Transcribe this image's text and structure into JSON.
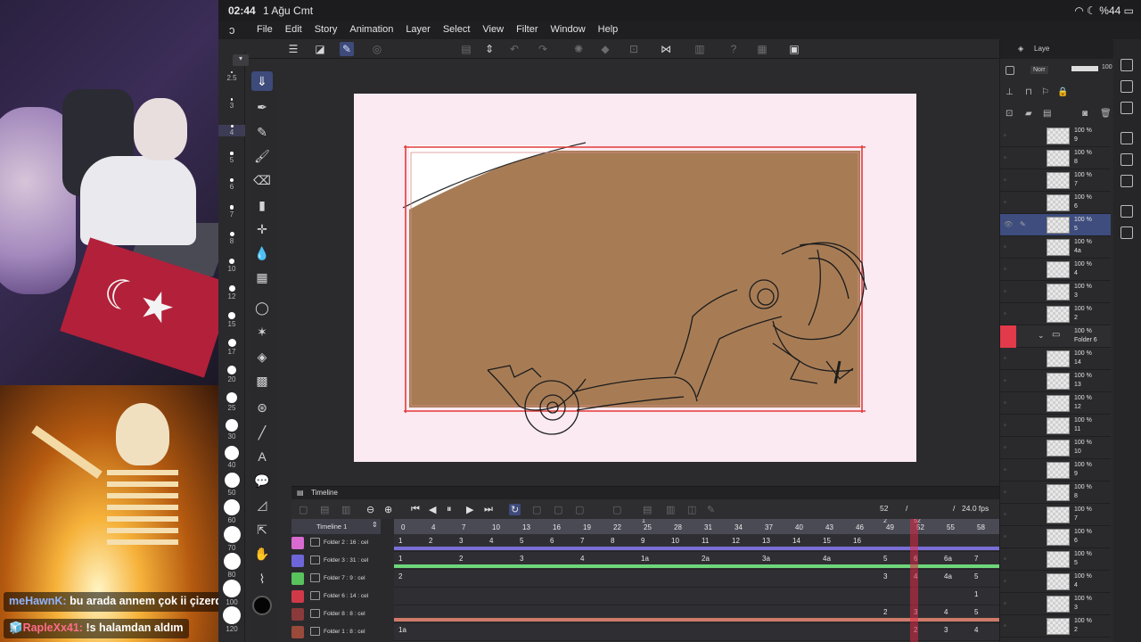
{
  "status": {
    "time": "02:44",
    "date": "1 Ağu Cmt",
    "battery": "%44"
  },
  "menu": {
    "items": [
      "File",
      "Edit",
      "Story",
      "Animation",
      "Layer",
      "Select",
      "View",
      "Filter",
      "Window",
      "Help"
    ]
  },
  "brush_sizes": [
    {
      "label": "2.5",
      "size": 2
    },
    {
      "label": "3",
      "size": 2.5
    },
    {
      "label": "4",
      "size": 3,
      "selected": true
    },
    {
      "label": "5",
      "size": 3.5
    },
    {
      "label": "6",
      "size": 4
    },
    {
      "label": "7",
      "size": 4.5
    },
    {
      "label": "8",
      "size": 5
    },
    {
      "label": "10",
      "size": 6
    },
    {
      "label": "12",
      "size": 7
    },
    {
      "label": "15",
      "size": 8
    },
    {
      "label": "17",
      "size": 9
    },
    {
      "label": "20",
      "size": 10
    },
    {
      "label": "25",
      "size": 12
    },
    {
      "label": "30",
      "size": 14
    },
    {
      "label": "40",
      "size": 16
    },
    {
      "label": "50",
      "size": 17
    },
    {
      "label": "60",
      "size": 18
    },
    {
      "label": "70",
      "size": 19
    },
    {
      "label": "80",
      "size": 19
    },
    {
      "label": "100",
      "size": 20
    },
    {
      "label": "120",
      "size": 20
    }
  ],
  "chat": {
    "msg1_user": "meHawnK:",
    "msg1_text": "bu arada annem çok ii çizerdir",
    "msg2_user": "RapleXx41:",
    "msg2_text": "!s halamdan aldım"
  },
  "timeline": {
    "title": "Timeline",
    "track_header": "Timeline 1",
    "current_frame": "52",
    "separator": "/",
    "fps": "24.0 fps",
    "ruler": [
      "0",
      "4",
      "7",
      "10",
      "13",
      "16",
      "19",
      "22",
      "25",
      "28",
      "31",
      "34",
      "37",
      "40",
      "43",
      "46",
      "49",
      "52",
      "55",
      "58"
    ],
    "ruler_top": [
      "1",
      "2",
      "52"
    ],
    "tracks": [
      {
        "name": "Folder 2 : 16 : cel",
        "color": "#d86ad0",
        "cells": [
          "1",
          "2",
          "3",
          "4",
          "5",
          "6",
          "7",
          "8",
          "9",
          "10",
          "11",
          "12",
          "13",
          "14",
          "15",
          "16"
        ],
        "bar": "#7a6fd6"
      },
      {
        "name": "Folder 3 : 31 : cel",
        "color": "#6e66d8",
        "cells": [
          "1",
          "2",
          "3",
          "4",
          "1a",
          "2a",
          "3a",
          "4a",
          "5",
          "6",
          "6a",
          "7"
        ],
        "bar": "#6ed67a"
      },
      {
        "name": "Folder 7 : 9 : cel",
        "color": "#58c25c",
        "cells": [
          "2",
          "3",
          "4",
          "4a",
          "5"
        ],
        "bar": ""
      },
      {
        "name": "Folder 6 : 14 : cel",
        "color": "#d03a48",
        "cells": [
          "1"
        ],
        "bar": ""
      },
      {
        "name": "Folder 8 : 8 : cel",
        "color": "#8a3a3a",
        "cells": [
          "2",
          "3",
          "4",
          "5"
        ],
        "bar": "#d07a6a"
      },
      {
        "name": "Folder 1 : 8 : cel",
        "color": "#9a4a3a",
        "cells": [
          "1a",
          "2",
          "3",
          "4"
        ],
        "bar": ""
      }
    ]
  },
  "layers": {
    "tab_label": "Laye",
    "blend": "Norr",
    "opacity": "100",
    "rows": [
      {
        "pct": "100 %",
        "name": "9"
      },
      {
        "pct": "100 %",
        "name": "8"
      },
      {
        "pct": "100 %",
        "name": "7"
      },
      {
        "pct": "100 %",
        "name": "6"
      },
      {
        "pct": "100 %",
        "name": "5",
        "selected": true
      },
      {
        "pct": "100 %",
        "name": "4a"
      },
      {
        "pct": "100 %",
        "name": "4"
      },
      {
        "pct": "100 %",
        "name": "3"
      },
      {
        "pct": "100 %",
        "name": "2"
      },
      {
        "pct": "100 %",
        "name": "Folder 6",
        "folder": true
      },
      {
        "pct": "100 %",
        "name": "14"
      },
      {
        "pct": "100 %",
        "name": "13"
      },
      {
        "pct": "100 %",
        "name": "12"
      },
      {
        "pct": "100 %",
        "name": "11"
      },
      {
        "pct": "100 %",
        "name": "10"
      },
      {
        "pct": "100 %",
        "name": "9"
      },
      {
        "pct": "100 %",
        "name": "8"
      },
      {
        "pct": "100 %",
        "name": "7"
      },
      {
        "pct": "100 %",
        "name": "6"
      },
      {
        "pct": "100 %",
        "name": "5"
      },
      {
        "pct": "100 %",
        "name": "4"
      },
      {
        "pct": "100 %",
        "name": "3"
      },
      {
        "pct": "100 %",
        "name": "2"
      }
    ]
  },
  "colors": {
    "canvas_fill": "#a77c55",
    "paper": "#fbeaf2",
    "frame_red": "#e33a3a",
    "accent": "#3d4a7a"
  }
}
